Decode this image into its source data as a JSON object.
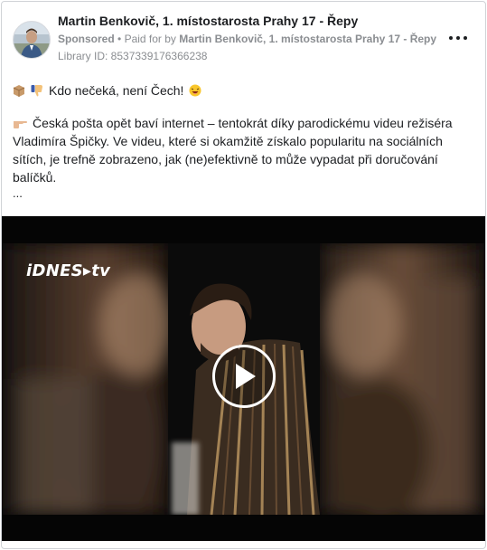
{
  "advertiser": {
    "name": "Martin Benkovič, 1. místostarosta Prahy 17 - Řepy",
    "sponsored_label": "Sponsored",
    "paid_for_prefix": "Paid for by",
    "paid_for_name": "Martin Benkovič, 1. místostarosta Prahy 17 - Řepy",
    "library_id": "Library ID: 8537339176366238"
  },
  "post": {
    "line1": "Kdo nečeká, není Čech!",
    "paragraph": "Česká pošta opět baví internet – tentokrát díky parodickému videu režiséra Vladimíra Špičky. Ve videu, které si okamžitě získalo popularitu na sociálních sítích, je trefně zobrazeno, jak (ne)efektivně to může vypadat při doručování balíčků.",
    "ellipsis": "..."
  },
  "video": {
    "logo_text": "iDNES▸tv"
  },
  "icons": {
    "more": "more-options-icon",
    "play": "play-icon",
    "package_emoji": "package-icon",
    "thumbs_down_emoji": "thumbs-down-icon",
    "laughing_emoji": "laughing-emoji-icon",
    "pointing_emoji": "pointing-hand-icon"
  }
}
